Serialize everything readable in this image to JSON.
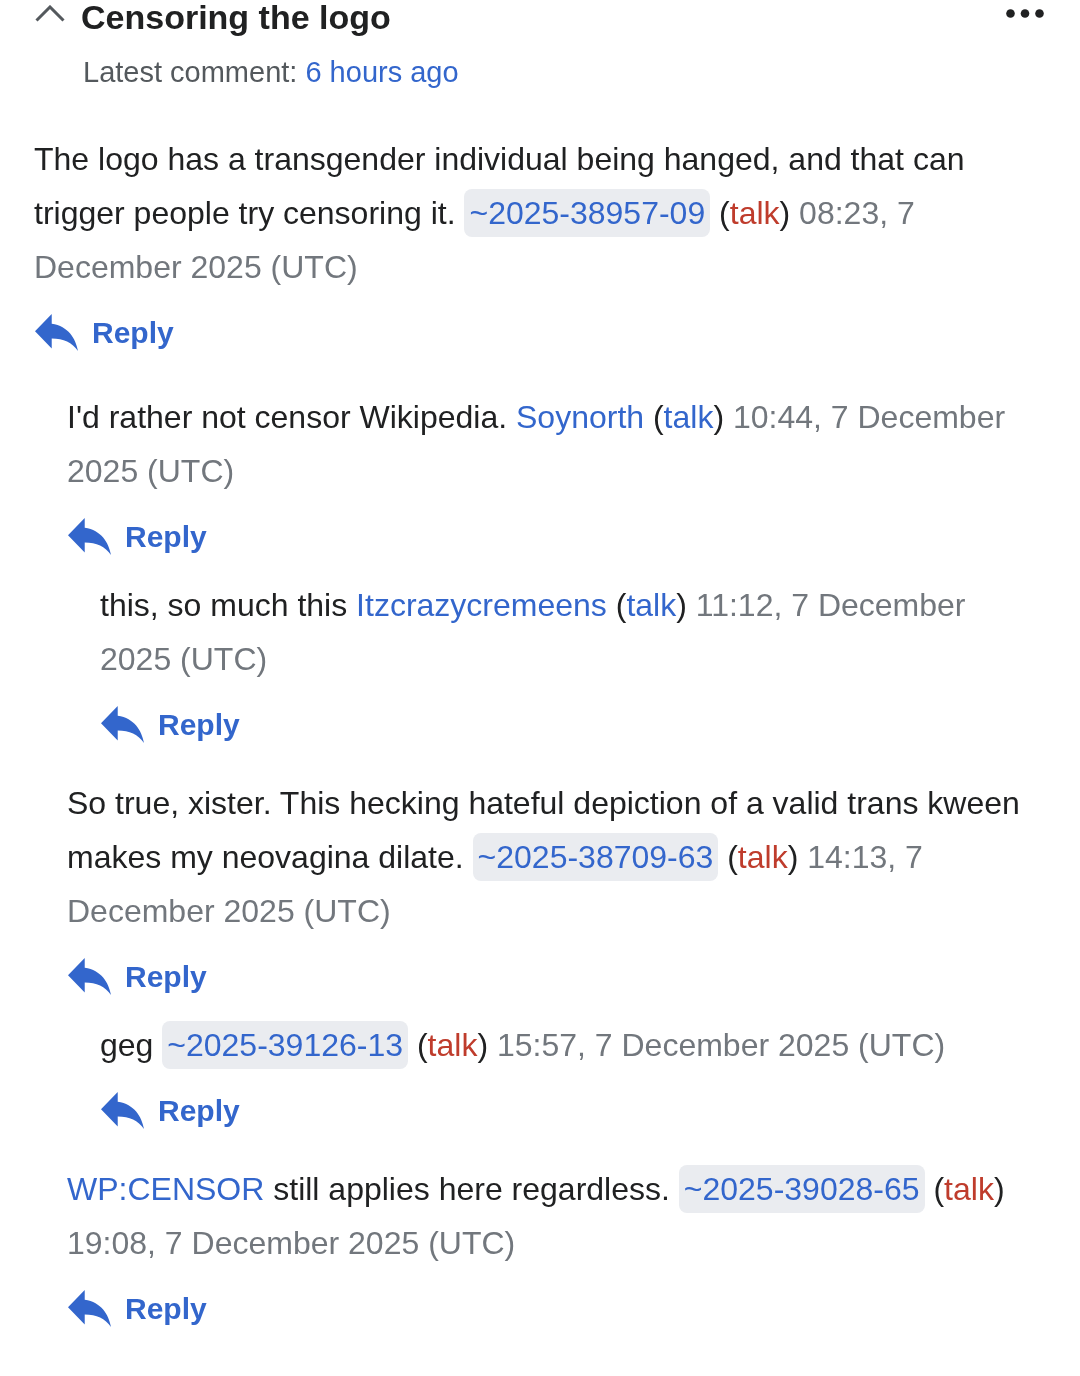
{
  "header": {
    "title": "Censoring the logo",
    "expanded": true,
    "latest_label": "Latest comment:",
    "latest_time": "6 hours ago"
  },
  "comments": [
    {
      "segments": [
        {
          "kind": "text",
          "text": "The logo has a transgender individual being hanged, and that can trigger people try censoring it. "
        },
        {
          "kind": "temp_user",
          "text": "~2025-38957-09"
        },
        {
          "kind": "text",
          "text": " ("
        },
        {
          "kind": "talk",
          "text": "talk",
          "missing": true
        },
        {
          "kind": "text",
          "text": ")"
        },
        {
          "kind": "timestamp",
          "text": " 08:23, 7 December 2025 (UTC)"
        }
      ],
      "reply": "Reply",
      "children": [
        {
          "segments": [
            {
              "kind": "text",
              "text": "I'd rather not censor Wikipedia. "
            },
            {
              "kind": "user",
              "text": "Soynorth"
            },
            {
              "kind": "text",
              "text": " ("
            },
            {
              "kind": "talk",
              "text": "talk",
              "missing": false
            },
            {
              "kind": "text",
              "text": ")"
            },
            {
              "kind": "timestamp",
              "text": " 10:44, 7 December 2025 (UTC)"
            }
          ],
          "reply": "Reply",
          "children": [
            {
              "segments": [
                {
                  "kind": "text",
                  "text": "this, so much this "
                },
                {
                  "kind": "user",
                  "text": "Itzcrazycremeens"
                },
                {
                  "kind": "text",
                  "text": " ("
                },
                {
                  "kind": "talk",
                  "text": "talk",
                  "missing": false
                },
                {
                  "kind": "text",
                  "text": ")"
                },
                {
                  "kind": "timestamp",
                  "text": " 11:12, 7 December 2025 (UTC)"
                }
              ],
              "reply": "Reply"
            }
          ]
        },
        {
          "segments": [
            {
              "kind": "text",
              "text": "So true, xister. This hecking hateful depiction of a valid trans kween makes my neovagina dilate. "
            },
            {
              "kind": "temp_user",
              "text": "~2025-38709-63"
            },
            {
              "kind": "text",
              "text": " ("
            },
            {
              "kind": "talk",
              "text": "talk",
              "missing": true
            },
            {
              "kind": "text",
              "text": ")"
            },
            {
              "kind": "timestamp",
              "text": " 14:13, 7 December 2025 (UTC)"
            }
          ],
          "reply": "Reply",
          "children": [
            {
              "segments": [
                {
                  "kind": "text",
                  "text": "geg "
                },
                {
                  "kind": "temp_user",
                  "text": "~2025-39126-13"
                },
                {
                  "kind": "text",
                  "text": " ("
                },
                {
                  "kind": "talk",
                  "text": "talk",
                  "missing": true
                },
                {
                  "kind": "text",
                  "text": ")"
                },
                {
                  "kind": "timestamp",
                  "text": " 15:57, 7 December 2025 (UTC)"
                }
              ],
              "reply": "Reply"
            }
          ]
        },
        {
          "segments": [
            {
              "kind": "link",
              "text": "WP:CENSOR"
            },
            {
              "kind": "text",
              "text": " still applies here regardless. "
            },
            {
              "kind": "temp_user",
              "text": "~2025-39028-65"
            },
            {
              "kind": "text",
              "text": " ("
            },
            {
              "kind": "talk",
              "text": "talk",
              "missing": true
            },
            {
              "kind": "text",
              "text": ")"
            },
            {
              "kind": "timestamp",
              "text": " 19:08, 7 December 2025 (UTC)"
            }
          ],
          "reply": "Reply"
        }
      ]
    }
  ]
}
